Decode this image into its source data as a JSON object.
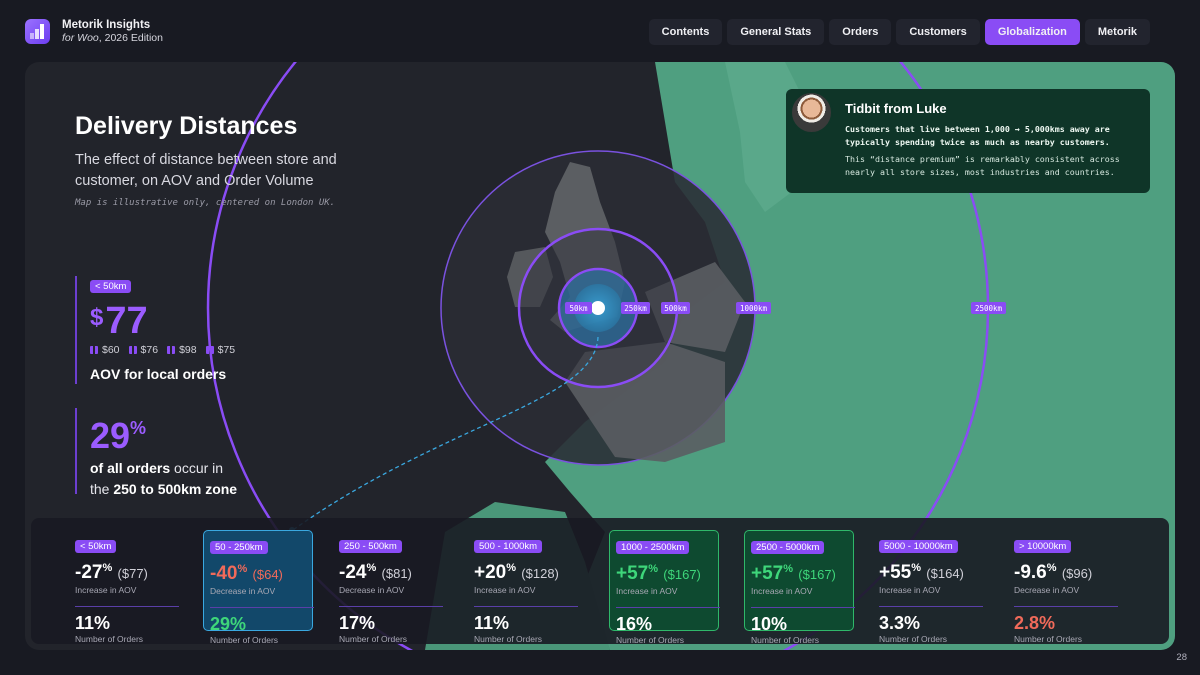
{
  "header": {
    "brand_title": "Metorik Insights",
    "brand_sub_italic": "for Woo",
    "brand_sub_rest": ", 2026 Edition",
    "tabs": [
      {
        "label": "Contents",
        "active": false
      },
      {
        "label": "General Stats",
        "active": false
      },
      {
        "label": "Orders",
        "active": false
      },
      {
        "label": "Customers",
        "active": false
      },
      {
        "label": "Globalization",
        "active": true
      },
      {
        "label": "Metorik",
        "active": false
      }
    ]
  },
  "main": {
    "title": "Delivery Distances",
    "subtitle": "The effect of distance between store and customer, on AOV and Order Volume",
    "note": "Map is illustrative only, centered on London UK.",
    "local": {
      "badge": "< 50km",
      "currency": "$",
      "value": "77",
      "sizes": [
        "$60",
        "$76",
        "$98",
        "$75"
      ],
      "label": "AOV for local orders"
    },
    "zone": {
      "value": "29",
      "unit": "%",
      "line1_bold": "of all orders",
      "line1_rest": " occur in",
      "line2_pre": "the ",
      "line2_bold": "250 to 500km zone"
    }
  },
  "map": {
    "ring_labels": [
      "50km",
      "250km",
      "500km",
      "1000km",
      "2500km"
    ]
  },
  "tidbit": {
    "title": "Tidbit from Luke",
    "p1": "Customers that live between 1,000 → 5,000kms away are typically spending twice as much as nearby customers.",
    "p2": "This “distance premium” is remarkably consistent across nearly all store sizes, most industries and countries."
  },
  "bands": [
    {
      "range": "< 50km",
      "change": "-27",
      "aov": "($77)",
      "aov_label": "Increase in AOV",
      "orders": "11%",
      "orders_label": "Number of Orders",
      "style": "plain"
    },
    {
      "range": "50 - 250km",
      "change": "-40",
      "aov": "($64)",
      "aov_label": "Decrease in AOV",
      "orders": "29%",
      "orders_label": "Number of Orders",
      "style": "blue"
    },
    {
      "range": "250 - 500km",
      "change": "-24",
      "aov": "($81)",
      "aov_label": "Decrease in AOV",
      "orders": "17%",
      "orders_label": "Number of Orders",
      "style": "plain"
    },
    {
      "range": "500 - 1000km",
      "change": "+20",
      "aov": "($128)",
      "aov_label": "Increase in AOV",
      "orders": "11%",
      "orders_label": "Number of Orders",
      "style": "plain"
    },
    {
      "range": "1000 - 2500km",
      "change": "+57",
      "aov": "($167)",
      "aov_label": "Increase in AOV",
      "orders": "16%",
      "orders_label": "Number of Orders",
      "style": "green"
    },
    {
      "range": "2500 - 5000km",
      "change": "+57",
      "aov": "($167)",
      "aov_label": "Increase in AOV",
      "orders": "10%",
      "orders_label": "Number of Orders",
      "style": "green"
    },
    {
      "range": "5000 - 10000km",
      "change": "+55",
      "aov": "($164)",
      "aov_label": "Increase in AOV",
      "orders": "3.3%",
      "orders_label": "Number of Orders",
      "style": "plain"
    },
    {
      "range": "> 10000km",
      "change": "-9.6",
      "aov": "($96)",
      "aov_label": "Decrease in AOV",
      "orders": "2.8%",
      "orders_label": "Number of Orders",
      "style": "plain",
      "orders_color": "red"
    }
  ],
  "page_number": "28",
  "colors": {
    "accent": "#8a4cf5",
    "map_green": "#4a9a7a",
    "highlight_blue": "#12486a",
    "highlight_green": "#0e4a30",
    "negative": "#f06a5a",
    "positive": "#3ed67a"
  }
}
